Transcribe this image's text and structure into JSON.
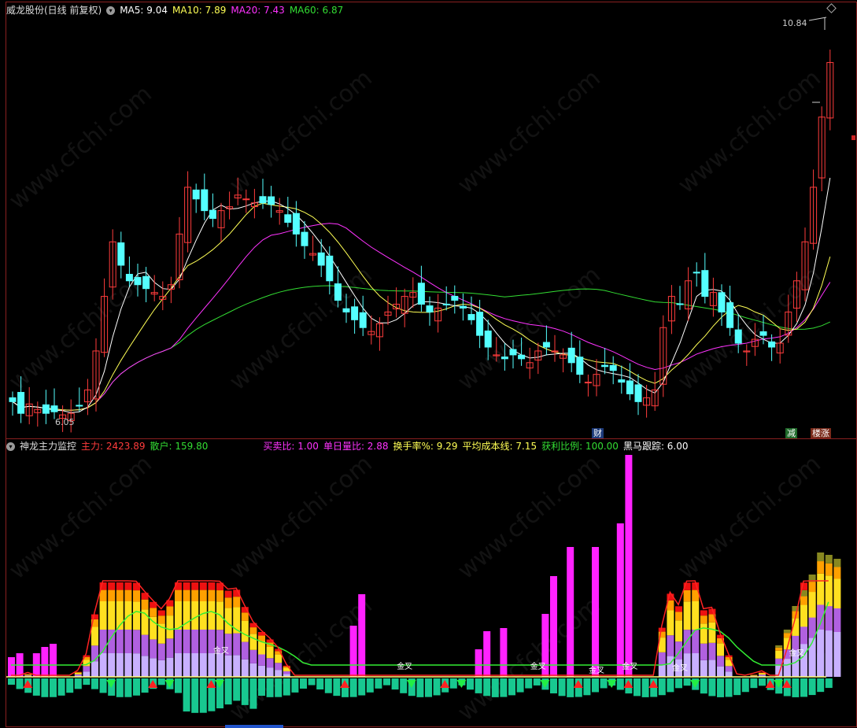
{
  "top_header": {
    "stock": "威龙股份(日线 前复权)",
    "ma5": "MA5: 9.04",
    "ma10": "MA10: 7.89",
    "ma20": "MA20: 7.43",
    "ma60": "MA60: 6.87"
  },
  "bottom_header": {
    "title": "神龙主力监控",
    "zhuli": "主力: 2423.89",
    "sanhu": "散户: 159.80",
    "maimai": "买卖比: 1.00",
    "danri": "单日量比: 2.88",
    "huanshou": "换手率%: 9.29",
    "pingjun": "平均成本线: 7.15",
    "huoli": "获利比例: 100.00",
    "heima": "黑马跟踪: 6.00"
  },
  "markers": {
    "high_label": "10.84",
    "low_label": "6.05",
    "cai": "财",
    "jian": "减",
    "louzhang": "楼涨",
    "jinjiao": "金叉"
  },
  "watermark": "www.cfchi.com",
  "colors": {
    "up": "#ff3c3c",
    "down": "#54ffff",
    "ma5": "#ffffff",
    "ma10": "#ffff55",
    "ma20": "#ff33ff",
    "ma60": "#33dd33",
    "magenta_bar": "#ff22ff",
    "panel_border": "#8a2020"
  },
  "chart_data": [
    {
      "type": "candlestick",
      "title": "威龙股份(日线 前复权)",
      "series_names": [
        "MA5",
        "MA10",
        "MA20",
        "MA60"
      ],
      "y_range": [
        5.9,
        11.2
      ],
      "high": 10.84,
      "low": 6.05,
      "close": [
        6.25,
        6.1,
        6.22,
        6.15,
        6.1,
        6.12,
        6.08,
        6.1,
        6.2,
        6.4,
        6.9,
        7.6,
        8.3,
        8.0,
        7.8,
        7.75,
        7.7,
        7.65,
        7.6,
        7.75,
        8.4,
        9.0,
        8.85,
        8.7,
        8.6,
        8.7,
        8.75,
        8.9,
        8.85,
        8.8,
        8.8,
        8.78,
        8.7,
        8.55,
        8.4,
        8.25,
        8.15,
        8.0,
        7.8,
        7.55,
        7.4,
        7.3,
        7.2,
        7.15,
        7.25,
        7.4,
        7.5,
        7.6,
        7.65,
        7.5,
        7.4,
        7.45,
        7.5,
        7.55,
        7.45,
        7.3,
        7.1,
        6.95,
        6.85,
        6.8,
        6.85,
        6.8,
        6.75,
        6.9,
        6.95,
        6.9,
        6.85,
        6.75,
        6.6,
        6.5,
        6.6,
        6.7,
        6.65,
        6.5,
        6.35,
        6.25,
        6.3,
        6.4,
        7.2,
        7.6,
        7.5,
        7.8,
        7.9,
        7.6,
        7.65,
        7.4,
        7.2,
        7.0,
        6.9,
        7.05,
        7.1,
        6.95,
        7.0,
        7.4,
        7.8,
        8.3,
        9.0,
        9.9,
        10.6
      ],
      "ma5_end": 9.04,
      "ma10_end": 7.89,
      "ma20_end": 7.43,
      "ma60_end": 6.87
    },
    {
      "type": "bar",
      "title": "神龙主力监控",
      "series_names": [
        "主力",
        "散户"
      ],
      "zhuli": 2423.89,
      "sanhu": 159.8,
      "note_values": [
        1.0,
        2.88,
        9.29,
        7.15,
        100.0,
        6.0
      ]
    }
  ]
}
